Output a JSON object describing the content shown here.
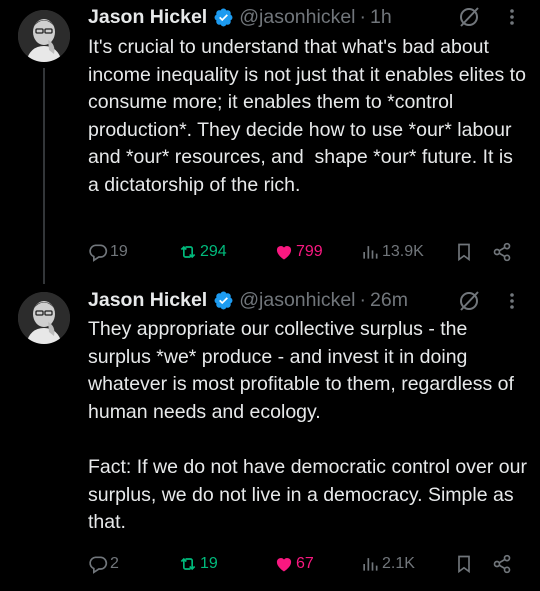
{
  "colors": {
    "background": "#000000",
    "text": "#e7e9ea",
    "muted": "#71767b",
    "verified": "#1d9bf0",
    "retweet": "#00ba7c",
    "like": "#f91880"
  },
  "tweets": [
    {
      "author": {
        "name": "Jason Hickel",
        "handle": "@jasonhickel",
        "verified": true
      },
      "time": "1h",
      "separator": "·",
      "text": "It's crucial to understand that what's bad about income inequality is not just that it enables elites to consume more; it enables them to *control production*. They decide how to use *our* labour and *our* resources, and  shape *our* future. It is a dictatorship of the rich.",
      "stats": {
        "replies": "19",
        "retweets": "294",
        "likes": "799",
        "views": "13.9K"
      },
      "liked": true,
      "retweeted": true,
      "icons": [
        "grok-icon",
        "more-icon",
        "reply-icon",
        "retweet-icon",
        "heart-icon",
        "views-icon",
        "bookmark-icon",
        "share-icon"
      ]
    },
    {
      "author": {
        "name": "Jason Hickel",
        "handle": "@jasonhickel",
        "verified": true
      },
      "time": "26m",
      "separator": "·",
      "text": "They appropriate our collective surplus - the surplus *we* produce - and invest it in doing whatever is most profitable to them, regardless of human needs and ecology.\n\nFact: If we do not have democratic control over our surplus, we do not live in a democracy. Simple as that.",
      "stats": {
        "replies": "2",
        "retweets": "19",
        "likes": "67",
        "views": "2.1K"
      },
      "liked": true,
      "retweeted": true,
      "icons": [
        "grok-icon",
        "more-icon",
        "reply-icon",
        "retweet-icon",
        "heart-icon",
        "views-icon",
        "bookmark-icon",
        "share-icon"
      ]
    }
  ]
}
